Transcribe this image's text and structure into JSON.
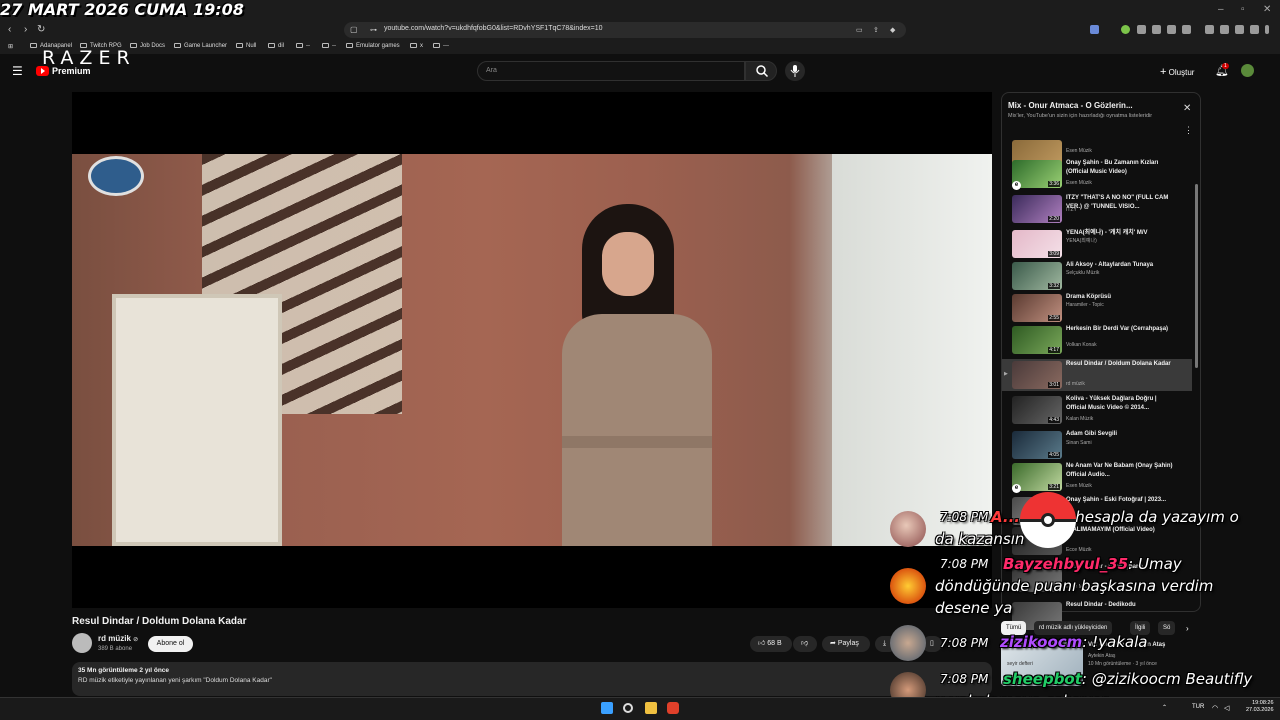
{
  "overlay": {
    "datetime": "27 MART 2026 CUMA 19:08"
  },
  "browser": {
    "url": "youtube.com/watch?v=ukdhfqfobG0&list=RDvhYSF1TqC78&index=10",
    "bookmarks": [
      "Adanapanel",
      "Twitch RPG",
      "Job Docs",
      "Game Launcher",
      "Null",
      "dil",
      "--",
      "--",
      "Emulator games",
      "x",
      "---"
    ]
  },
  "youtube": {
    "brand": "RAZER",
    "premium": "Premium",
    "search_placeholder": "Ara",
    "create_label": "Oluştur",
    "notif_count": "1"
  },
  "video": {
    "title": "Resul Dindar / Doldum Dolana Kadar",
    "channel": "rd müzik",
    "channel_verified": "⊘",
    "subscribers": "389 B abone",
    "subscribe_label": "Abone ol",
    "likes": "68 B",
    "share_label": "Paylaş",
    "views_date": "35 Mn görüntüleme  2 yıl önce",
    "description": "RD müzik etiketiyle yayınlanan yeni şarkım \"Doldum Dolana Kadar\""
  },
  "playlist": {
    "title": "Mix - Onur Atmaca - O Gözlerin...",
    "subtitle": "Mix'ler, YouTube'un sizin için hazırladığı oynatma listeleridir",
    "items": [
      {
        "title": "",
        "channel": "Esen Müzik",
        "duration": "2:45",
        "e": true,
        "c1": "#8a6a3a",
        "c2": "#c09a60"
      },
      {
        "title": "Onay Şahin - Bu Zamanın Kızları (Official Music Video)",
        "channel": "Esen Müzik",
        "duration": "3:36",
        "e": true,
        "c1": "#2d6b2a",
        "c2": "#9ad074"
      },
      {
        "title": "ITZY \"THAT'S A NO NO\" (FULL CAM VER.) @ 'TUNNEL VISIO...",
        "channel": "ITZY",
        "duration": "2:20",
        "e": false,
        "c1": "#3a2a5a",
        "c2": "#b080c0"
      },
      {
        "title": "YENA(최예나) - '캐치 캐치' M/V",
        "channel": "YENA(최예나)",
        "duration": "3:09",
        "e": false,
        "c1": "#e4b8c8",
        "c2": "#f4e0e8"
      },
      {
        "title": "Ali Aksoy - Altaylardan Tunaya",
        "channel": "Selçuklu Müzik",
        "duration": "3:32",
        "e": false,
        "c1": "#3a5a4a",
        "c2": "#a0b8a0"
      },
      {
        "title": "Drama Köprüsü",
        "channel": "Haramiler - Topic",
        "duration": "2:55",
        "e": false,
        "c1": "#5a3a30",
        "c2": "#c09080"
      },
      {
        "title": "Herkesin Bir Derdi Var (Cerrahpaşa)",
        "channel": "Volkan Konak",
        "duration": "4:17",
        "e": false,
        "c1": "#2e5a22",
        "c2": "#7aa85a"
      },
      {
        "title": "Resul Dindar / Doldum Dolana Kadar",
        "channel": "rd müzik",
        "duration": "3:01",
        "e": false,
        "c1": "#4a3a3a",
        "c2": "#8a6a60",
        "active": true
      },
      {
        "title": "Koliva - Yüksek Dağlara Doğru | Official Music Video © 2014...",
        "channel": "Kalan Müzik",
        "duration": "4:43",
        "e": false,
        "c1": "#222222",
        "c2": "#666666"
      },
      {
        "title": "Adam Gibi Sevgili",
        "channel": "Sinan Sami",
        "duration": "4:05",
        "e": false,
        "c1": "#1a2a3a",
        "c2": "#5a7a8a"
      },
      {
        "title": "Ne Anam Var Ne Babam (Onay Şahin) Official Audio...",
        "channel": "Esen Müzik",
        "duration": "3:21",
        "e": true,
        "c1": "#3a6a2a",
        "c2": "#c0d8a0"
      },
      {
        "title": "Onay Şahin - Eski Fotoğraf | 2023...",
        "channel": "",
        "duration": "",
        "e": false,
        "c1": "#4a4a4a",
        "c2": "#9a9a9a"
      },
      {
        "title": "... ALIMAMAYIM (Official Video)",
        "channel": "Ecce Müzik",
        "duration": "",
        "e": false,
        "c1": "#222222",
        "c2": "#555555"
      },
      {
        "title": "Resul Dindar - Gümüşhane",
        "channel": "Esen Müzik",
        "duration": "",
        "e": false,
        "c1": "#333333",
        "c2": "#777777"
      },
      {
        "title": "Resul Dindar - Dedikodu",
        "channel": "",
        "duration": "",
        "e": false,
        "c1": "#3a3a3a",
        "c2": "#777777"
      }
    ]
  },
  "chips": [
    "Tümü",
    "rd müzik adlı yükleyiciden",
    "İlgili",
    "Sö"
  ],
  "under_chips": {
    "title": "Var Git Olum - Aytekin Ataş",
    "channel": "Aytekin Ataş",
    "views": "10 Mn görüntüleme · 3 yıl önce",
    "thumb_text": "seyir defteri"
  },
  "chat": [
    {
      "time": "7:08 PM",
      "user": "A...",
      "user_color": "#ff3b3b",
      "text": ": Diğer hesapla da yazayım o da kazansın"
    },
    {
      "time": "7:08 PM",
      "user": "Bayzehbyul_35",
      "user_color": "#ff2a6a",
      "text": ": Umay döndüğünde puanı başkasına verdim desene ya"
    },
    {
      "time": "7:08 PM",
      "user": "zizikoocm",
      "user_color": "#b04cff",
      "text": ": !yakala"
    },
    {
      "time": "7:08 PM",
      "user": "sheepbot",
      "user_color": "#22cc66",
      "text": ": @zizikoocm Beautifly u yakalamaya çalışıyor."
    }
  ],
  "taskbar": {
    "time": "19:08:26",
    "date": "27.03.2026",
    "lang": "TUR"
  }
}
